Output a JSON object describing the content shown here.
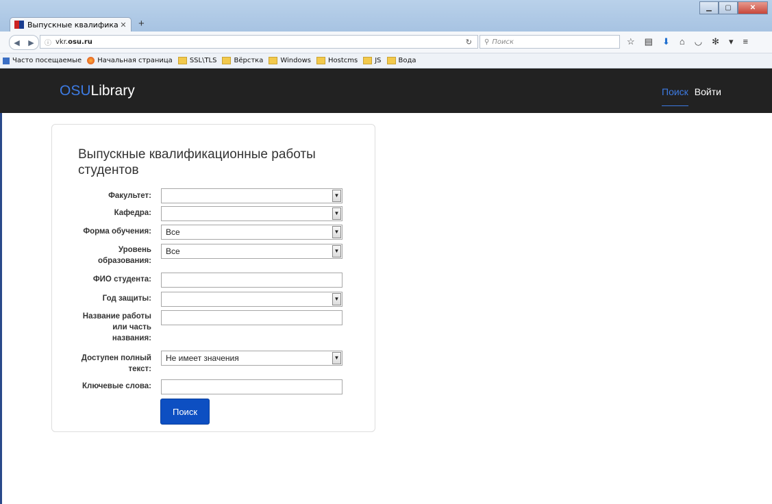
{
  "browser": {
    "tab_title": "Выпускные квалификаци...",
    "url_prefix": "vkr.",
    "url_domain": "osu.ru",
    "search_placeholder": "Поиск",
    "bookmarks": [
      {
        "label": "Часто посещаемые",
        "icon": "most-visited-icon"
      },
      {
        "label": "Начальная страница",
        "icon": "firefox-icon"
      },
      {
        "label": "SSL\\TLS",
        "icon": "folder-icon"
      },
      {
        "label": "Вёрстка",
        "icon": "folder-icon"
      },
      {
        "label": "Windows",
        "icon": "folder-icon"
      },
      {
        "label": "Hostcms",
        "icon": "folder-icon"
      },
      {
        "label": "JS",
        "icon": "folder-icon"
      },
      {
        "label": "Вода",
        "icon": "folder-icon"
      }
    ]
  },
  "site": {
    "brand_accent": "OSU",
    "brand_rest": "Library",
    "nav": {
      "search": "Поиск",
      "login": "Войти"
    },
    "accent_color": "#3d7be3",
    "navbar_color": "#222222"
  },
  "form": {
    "title": "Выпускные квалификационные работы студентов",
    "fields": {
      "faculty": {
        "label": "Факультет:",
        "value": ""
      },
      "department": {
        "label": "Кафедра:",
        "value": ""
      },
      "study_form": {
        "label": "Форма обучения:",
        "value": "Все"
      },
      "edu_level": {
        "label": "Уровень образования:",
        "value": "Все"
      },
      "student_name": {
        "label": "ФИО студента:",
        "value": ""
      },
      "defense_year": {
        "label": "Год защиты:",
        "value": ""
      },
      "work_title": {
        "label": "Название работы или часть названия:",
        "value": ""
      },
      "full_text": {
        "label": "Доступен полный текст:",
        "value": "Не имеет значения"
      },
      "keywords": {
        "label": "Ключевые слова:",
        "value": ""
      }
    },
    "submit_label": "Поиск",
    "button_color": "#0d4fc2"
  }
}
